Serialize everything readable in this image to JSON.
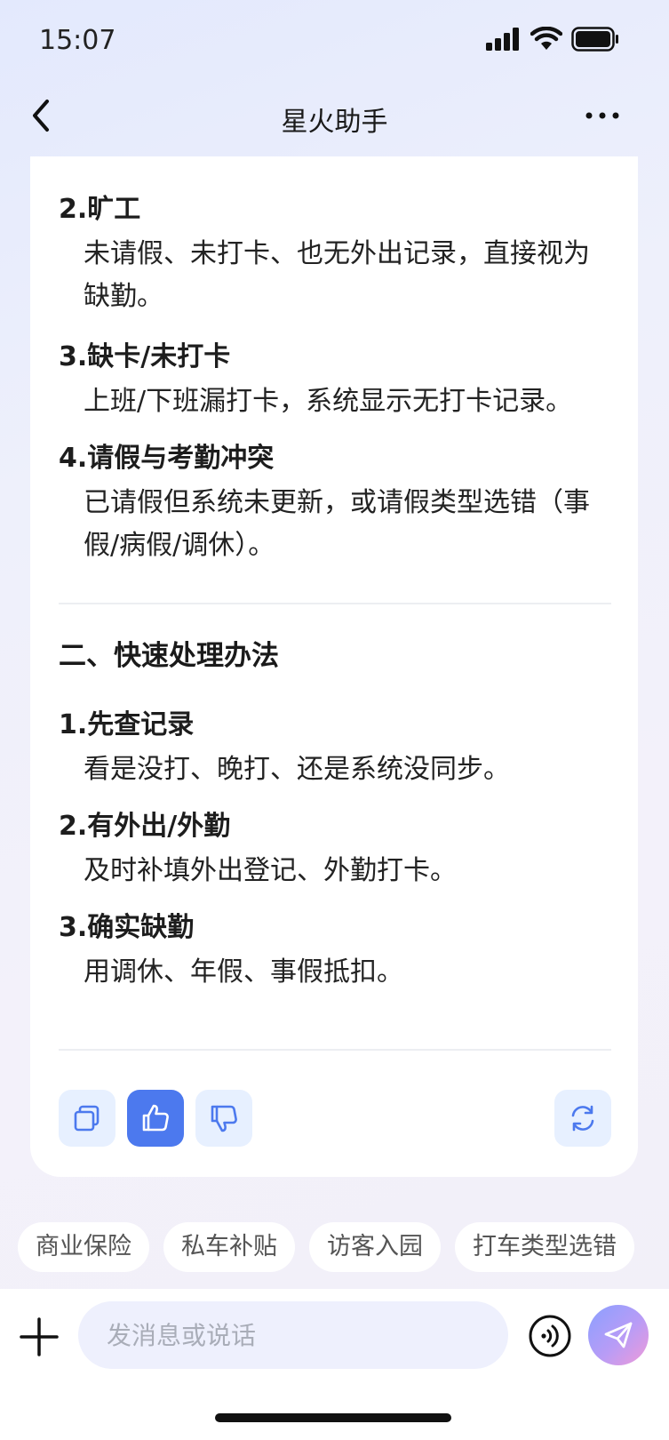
{
  "status_bar": {
    "time": "15:07"
  },
  "nav": {
    "title": "星火助手"
  },
  "answer": {
    "section1_items": [
      {
        "title": "2.旷工",
        "desc": "未请假、未打卡、也无外出记录，直接视为缺勤。"
      },
      {
        "title": "3.缺卡/未打卡",
        "desc": "上班/下班漏打卡，系统显示无打卡记录。"
      },
      {
        "title": "4.请假与考勤冲突",
        "desc": "已请假但系统未更新，或请假类型选错（事假/病假/调休）。"
      }
    ],
    "section2_title": "二、快速处理办法",
    "section2_items": [
      {
        "title": "1.先查记录",
        "desc": "看是没打、晚打、还是系统没同步。"
      },
      {
        "title": "2.有外出/外勤",
        "desc": "及时补填外出登记、外勤打卡。"
      },
      {
        "title": "3.确实缺勤",
        "desc": "用调休、年假、事假抵扣。"
      }
    ]
  },
  "actions": {
    "copy_icon": "copy-icon",
    "like_icon": "thumbs-up-icon",
    "dislike_icon": "thumbs-down-icon",
    "regenerate_icon": "refresh-icon",
    "accent_color": "#4c79ee"
  },
  "suggestions": [
    "商业保险",
    "私车补贴",
    "访客入园",
    "打车类型选错"
  ],
  "composer": {
    "placeholder": "发消息或说话"
  }
}
